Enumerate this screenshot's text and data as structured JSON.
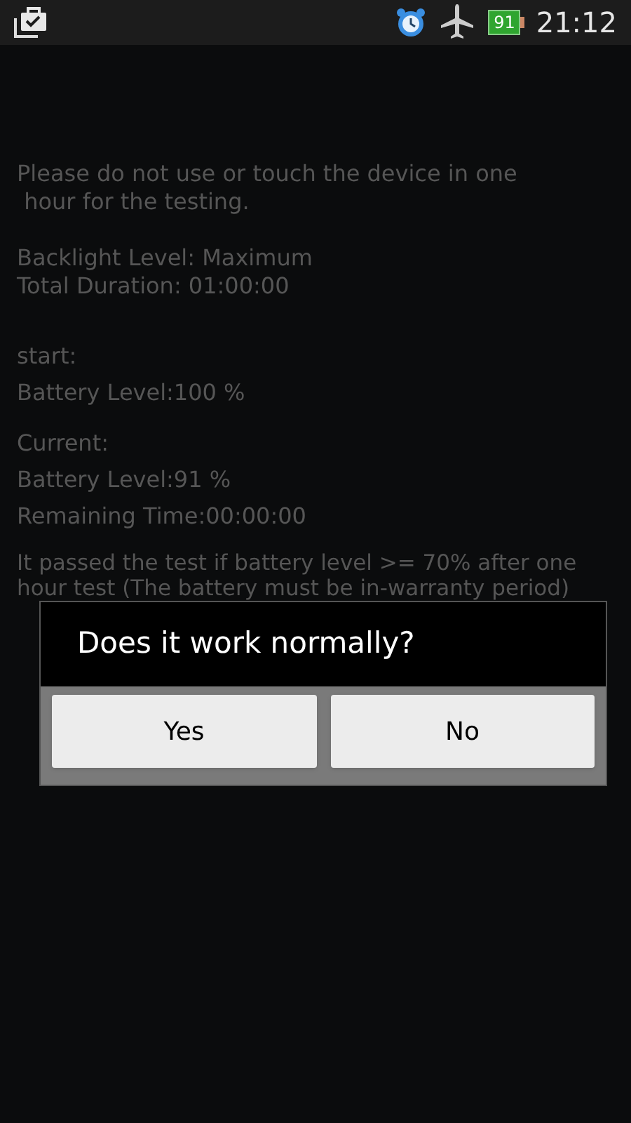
{
  "status_bar": {
    "battery": "91",
    "time": "21:12"
  },
  "body": {
    "notice": "Please do not use or touch the device in one\n hour for the testing.",
    "settings": [
      "Backlight Level: Maximum",
      "Total Duration: 01:00:00"
    ],
    "start_heading": "start:",
    "start_lines": [
      "Battery Level:100 %"
    ],
    "current_heading": "Current:",
    "current_lines": [
      "Battery Level:91 %",
      "Remaining Time:00:00:00"
    ],
    "criteria": "It passed the test if battery level >= 70% after one\nhour test (The battery must be in-warranty period)"
  },
  "dialog": {
    "message": "Does it work normally?",
    "buttons": [
      "Yes",
      "No"
    ]
  }
}
